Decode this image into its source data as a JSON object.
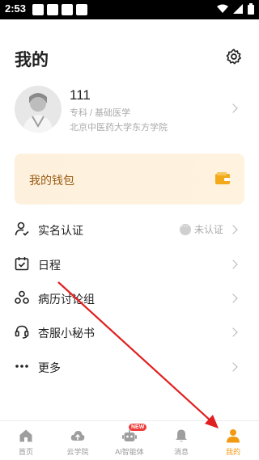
{
  "status_bar": {
    "time": "2:53"
  },
  "header": {
    "title": "我的"
  },
  "profile": {
    "name": "111",
    "major": "专科 / 基础医学",
    "school": "北京中医药大学东方学院"
  },
  "wallet": {
    "label": "我的钱包"
  },
  "menu": {
    "items": [
      {
        "label": "实名认证",
        "status": "未认证"
      },
      {
        "label": "日程"
      },
      {
        "label": "病历讨论组"
      },
      {
        "label": "杏服小秘书"
      },
      {
        "label": "更多"
      }
    ]
  },
  "tabbar": {
    "tabs": [
      {
        "label": "首页"
      },
      {
        "label": "云学院"
      },
      {
        "label": "AI智能体",
        "badge": "NEW"
      },
      {
        "label": "消息"
      },
      {
        "label": "我的"
      }
    ]
  },
  "colors": {
    "accent": "#f29a12",
    "wallet_text": "#9a5a12",
    "badge": "#ef3b3b",
    "annotation_arrow": "#e02020"
  }
}
